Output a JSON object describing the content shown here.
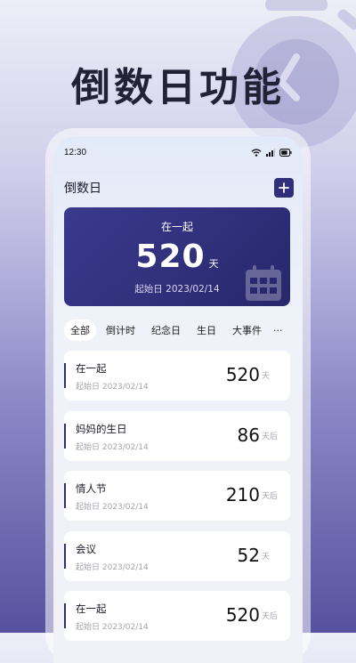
{
  "promo": {
    "title": "倒数日功能"
  },
  "status_bar": {
    "time": "12:30"
  },
  "header": {
    "title": "倒数日",
    "add_icon": "plus-icon"
  },
  "hero": {
    "label": "在一起",
    "days": "520",
    "unit": "天",
    "start": "起始日 2023/02/14",
    "icon": "calendar-icon"
  },
  "tabs": [
    {
      "label": "全部",
      "active": true
    },
    {
      "label": "倒计时"
    },
    {
      "label": "纪念日"
    },
    {
      "label": "生日"
    },
    {
      "label": "大事件"
    }
  ],
  "tabs_more": "···",
  "events": [
    {
      "name": "在一起",
      "start": "起始日 2023/02/14",
      "days": "520",
      "unit": "天"
    },
    {
      "name": "妈妈的生日",
      "start": "起始日 2023/02/14",
      "days": "86",
      "unit": "天后"
    },
    {
      "name": "情人节",
      "start": "起始日 2023/02/14",
      "days": "210",
      "unit": "天后"
    },
    {
      "name": "会议",
      "start": "起始日 2023/02/14",
      "days": "52",
      "unit": "天"
    },
    {
      "name": "在一起",
      "start": "起始日 2023/02/14",
      "days": "520",
      "unit": "天后"
    }
  ],
  "colors": {
    "accent": "#2f2f7a",
    "hero_bg": "#30307a"
  }
}
